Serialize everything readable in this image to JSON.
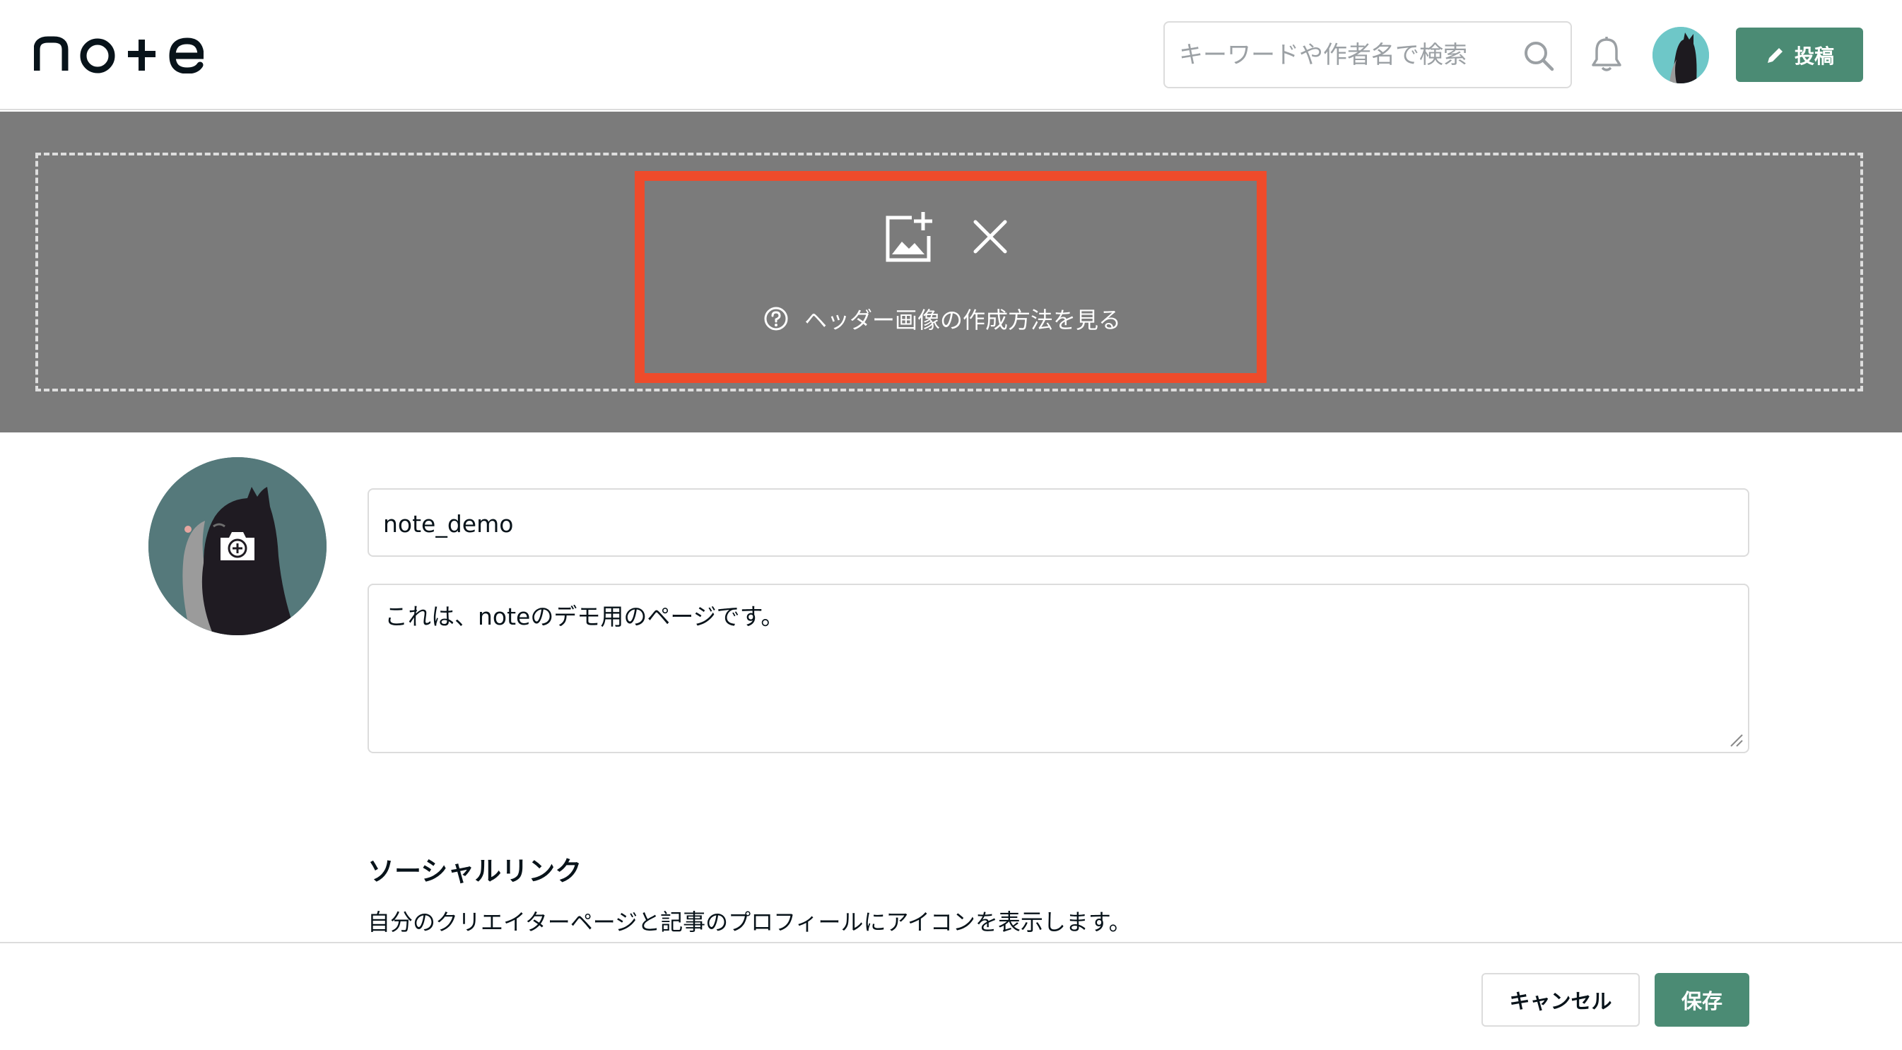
{
  "brand": {
    "logo_text": "note",
    "accent_color": "#4b8b74",
    "highlight_color": "#ee4b2b"
  },
  "topnav": {
    "search": {
      "placeholder": "キーワードや作者名で検索",
      "value": "",
      "icon": "search-icon"
    },
    "notifications_icon": "bell-icon",
    "avatar": "user-avatar",
    "post_button": {
      "label": "投稿",
      "icon": "pencil-icon"
    }
  },
  "header_image": {
    "add_icon": "add-image-icon",
    "remove_icon": "close-icon",
    "help_icon": "question-circle-icon",
    "help_text": "ヘッダー画像の作成方法を見る"
  },
  "profile": {
    "avatar_action_icon": "camera-plus-icon",
    "name_value": "note_demo",
    "bio_value": "これは、noteのデモ用のページです。"
  },
  "social": {
    "title": "ソーシャルリンク",
    "description": "自分のクリエイターページと記事のプロフィールにアイコンを表示します。"
  },
  "footer": {
    "cancel_label": "キャンセル",
    "save_label": "保存"
  }
}
